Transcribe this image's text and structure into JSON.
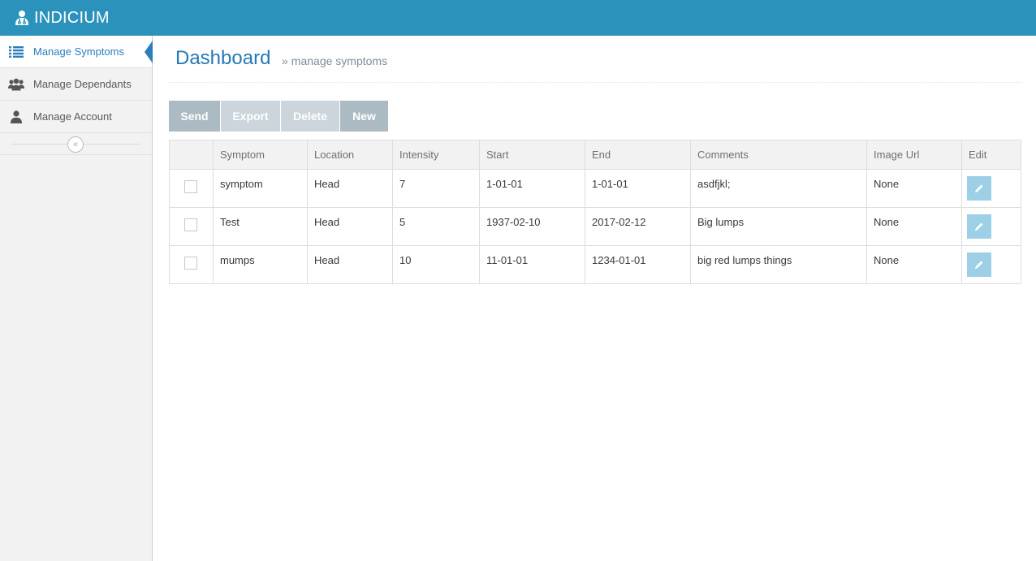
{
  "app": {
    "brand": "INDICIUM",
    "brand_icon": "user-doctor-icon",
    "colors": {
      "navbar": "#2b93bb",
      "accent": "#2b7dbc",
      "edit_button": "#9dd0e6"
    }
  },
  "sidebar": {
    "items": [
      {
        "label": "Manage Symptoms",
        "icon": "list-icon",
        "active": true
      },
      {
        "label": "Manage Dependants",
        "icon": "users-icon",
        "active": false
      },
      {
        "label": "Manage Account",
        "icon": "user-icon",
        "active": false
      }
    ],
    "collapse_icon": "double-chevron-left-icon",
    "collapse_glyph": "«"
  },
  "header": {
    "title": "Dashboard",
    "separator": "»",
    "breadcrumb": "manage symptoms"
  },
  "toolbar": {
    "send_label": "Send",
    "export_label": "Export",
    "delete_label": "Delete",
    "new_label": "New"
  },
  "table": {
    "columns": [
      "Symptom",
      "Location",
      "Intensity",
      "Start",
      "End",
      "Comments",
      "Image Url",
      "Edit"
    ],
    "rows": [
      {
        "symptom": "symptom",
        "location": "Head",
        "intensity": "7",
        "start": "1-01-01",
        "end": "1-01-01",
        "comments": "asdfjkl;",
        "image_url": "None"
      },
      {
        "symptom": "Test",
        "location": "Head",
        "intensity": "5",
        "start": "1937-02-10",
        "end": "2017-02-12",
        "comments": "Big lumps",
        "image_url": "None"
      },
      {
        "symptom": "mumps",
        "location": "Head",
        "intensity": "10",
        "start": "11-01-01",
        "end": "1234-01-01",
        "comments": "big red lumps things",
        "image_url": "None"
      }
    ],
    "edit_icon": "pencil-icon"
  }
}
